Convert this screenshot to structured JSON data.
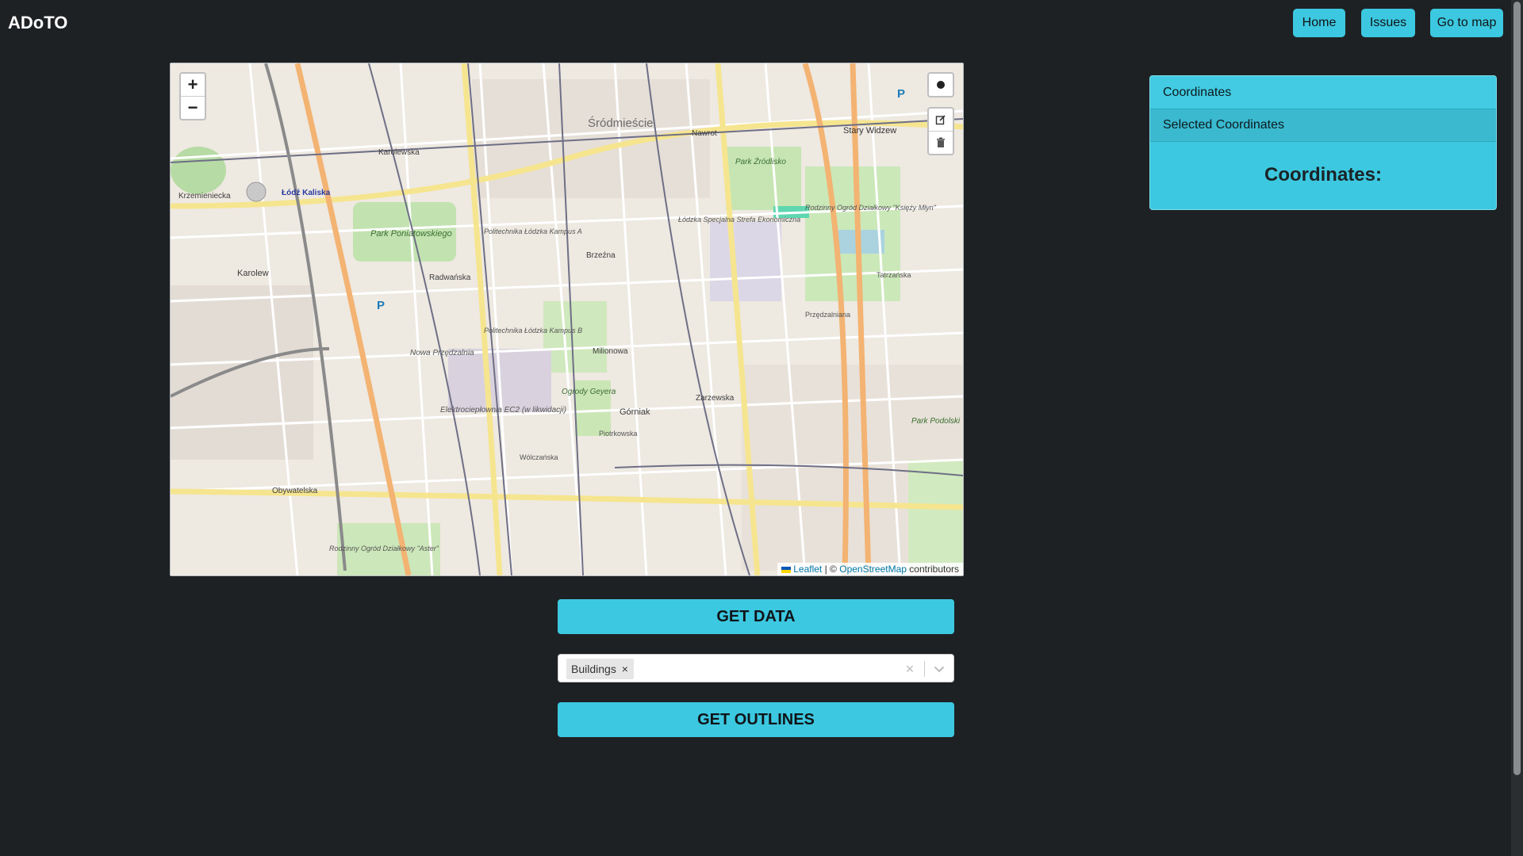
{
  "header": {
    "brand": "ADoTO",
    "nav": [
      {
        "label": "Home"
      },
      {
        "label": "Issues"
      },
      {
        "label": "Go to map"
      }
    ]
  },
  "map": {
    "zoom_in": "+",
    "zoom_out": "−",
    "draw_controls": [
      "circle-marker-icon",
      "edit-icon",
      "trash-icon"
    ],
    "attribution": {
      "leaflet": "Leaflet",
      "separator": "| ©",
      "osm": "OpenStreetMap",
      "suffix": "contributors"
    },
    "labels": {
      "srodmiescie": "Śródmieście",
      "stary_widzew": "Stary Widzew",
      "lodz_kaliska": "Łódź Kaliska",
      "park_poniatowskiego": "Park Poniatowskiego",
      "karolew": "Karolew",
      "park_zrodlisko": "Park Źródlisko",
      "gorniak": "Górniak",
      "park_podolski": "Park Podolski",
      "nowa_przedzalnia": "Nowa Przędzalnia",
      "ogrody_geyera": "Ogrody Geyera",
      "kampus_a": "Politechnika Łódzka Kampus A",
      "kampus_b": "Politechnika Łódzka Kampus B",
      "lsse": "Łódzka Specjalna Strefa Ekonomiczna",
      "elektro": "Elektrociepłownia EC2 (w likwidacji)",
      "rod_ksiezy": "Rodzinny Ogród Działkowy \"Księży Młyn\"",
      "rod_aster": "Rodzinny Ogród Działkowy \"Aster\"",
      "nawrot": "Nawrot",
      "brzezna": "Brzeźna",
      "milionowa": "Milionowa",
      "radwanska": "Radwańska",
      "obywatelska": "Obywatelska",
      "zarzewska": "Zarzewska",
      "krzemieniecka": "Krzemieniecka",
      "karolewska": "Karolewska",
      "piotrkowska": "Piotrkowska",
      "wolczanska": "Wólczańska",
      "przybyszewskiego": "Przędzalniana",
      "tatrzanska": "Tatrzańska",
      "parking": "P"
    }
  },
  "actions": {
    "get_data": "GET DATA",
    "get_outlines": "GET OUTLINES"
  },
  "select": {
    "chips": [
      {
        "label": "Buildings",
        "remove": "×"
      }
    ],
    "clear": "×"
  },
  "panel": {
    "header": "Coordinates",
    "subheader": "Selected Coordinates",
    "body_title": "Coordinates:"
  },
  "colors": {
    "background": "#1e2124",
    "accent": "#3cc8e0",
    "map_link": "#0078a8"
  }
}
